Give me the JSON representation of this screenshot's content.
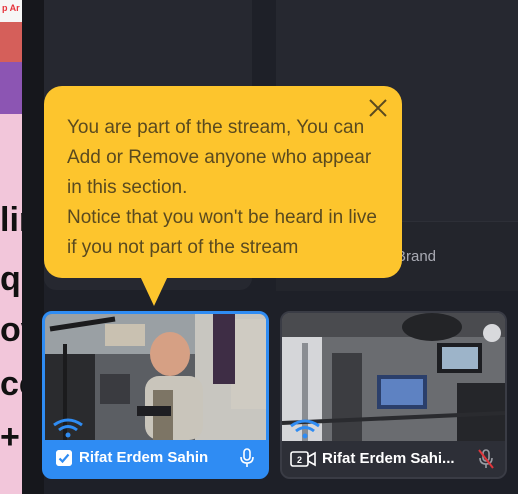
{
  "background_page": {
    "top_snippet": "p Ar",
    "letters": [
      "lin",
      "q",
      "ov",
      "cc",
      "+"
    ]
  },
  "stage": {
    "brand_label": "Brand"
  },
  "tooltip": {
    "text": "You are part of the stream, You can Add or Remove anyone who appear in this section.\nNotice that you won't be heard in live if you not part of the stream",
    "close_icon": "close-icon",
    "color": "#fdc52d"
  },
  "participants": [
    {
      "name": "Rifat Erdem Sahin",
      "in_stream": true,
      "selector_icon": "checkbox-checked-icon",
      "mic_icon": "microphone-icon",
      "mic_muted": false,
      "accent": "#2f8cf3"
    },
    {
      "name": "Rifat Erdem Sahi...",
      "in_stream": false,
      "selector_icon": "add-to-stream-icon",
      "selector_label": "2",
      "mic_icon": "microphone-muted-icon",
      "mic_muted": true,
      "accent": "#e0353a"
    }
  ]
}
